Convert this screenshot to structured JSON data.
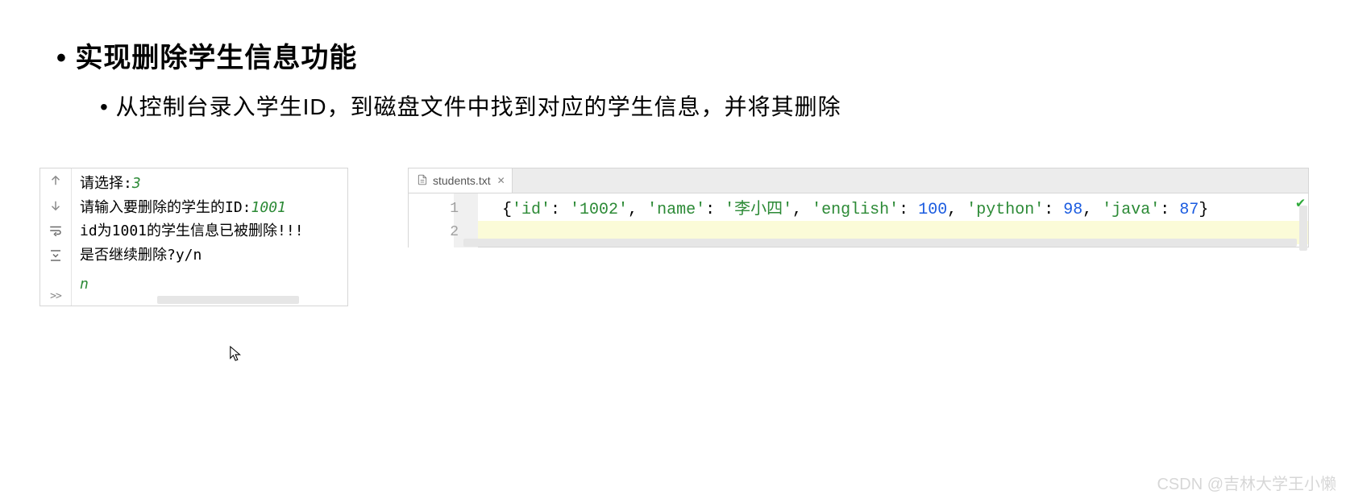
{
  "heading": {
    "main": "实现删除学生信息功能",
    "sub": "从控制台录入学生ID，到磁盘文件中找到对应的学生信息，并将其删除"
  },
  "console": {
    "line1_prefix": "请选择:",
    "line1_input": "3",
    "line2_prefix": "请输入要删除的学生的ID:",
    "line2_input": "1001",
    "line3": "id为1001的学生信息已被删除!!!",
    "line4": "是否继续删除?y/n",
    "line5": "n"
  },
  "editor": {
    "tab_label": "students.txt",
    "line_numbers": [
      "1",
      "2"
    ],
    "code": {
      "pre": "{",
      "k1": "'id'",
      "c1": ": ",
      "v1": "'1002'",
      "c2": ", ",
      "k2": "'name'",
      "c3": ": ",
      "v2": "'李小四'",
      "c4": ", ",
      "k3": "'english'",
      "c5": ": ",
      "v3": "100",
      "c6": ", ",
      "k4": "'python'",
      "c7": ": ",
      "v4": "98",
      "c8": ", ",
      "k5": "'java'",
      "c9": ": ",
      "v5": "87",
      "post": "}"
    }
  },
  "watermark": "CSDN @吉林大学王小懒"
}
